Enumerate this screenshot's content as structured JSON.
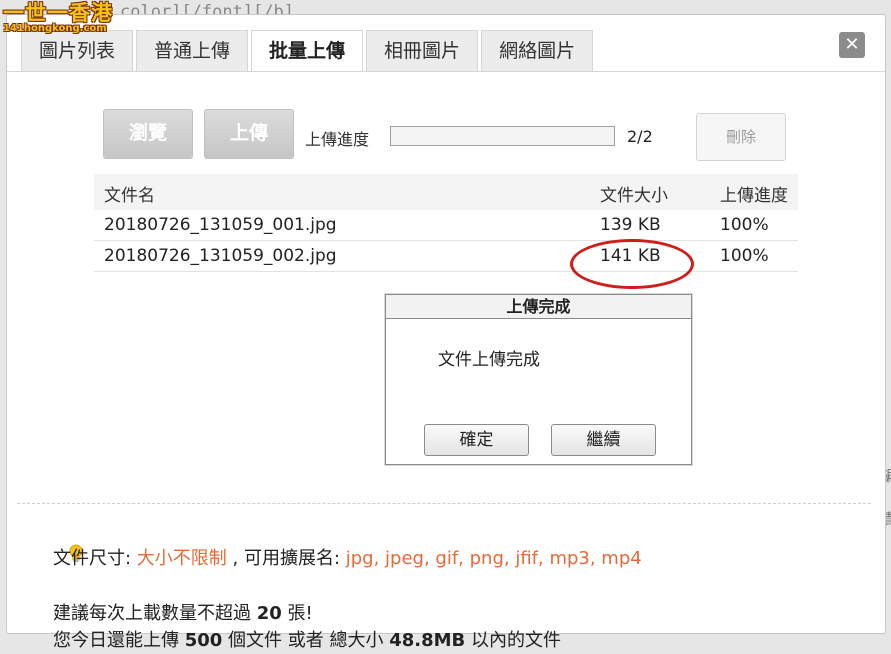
{
  "background_text": "color][/font][/b]",
  "right_edge_text": [
    "編",
    "責"
  ],
  "watermark": {
    "main": "一世一香港",
    "sub": "141hongkong.com"
  },
  "tabs": [
    {
      "label": "圖片列表",
      "active": false
    },
    {
      "label": "普通上傳",
      "active": false
    },
    {
      "label": "批量上傳",
      "active": true
    },
    {
      "label": "相冊圖片",
      "active": false
    },
    {
      "label": "網絡圖片",
      "active": false
    }
  ],
  "close_label": "✕",
  "toolbar": {
    "browse_label": "瀏覽",
    "upload_label": "上傳",
    "progress_label": "上傳進度",
    "progress_count": "2/2",
    "progress_value": 1.0,
    "delete_label": "刪除"
  },
  "table": {
    "headers": {
      "name": "文件名",
      "size": "文件大小",
      "progress": "上傳進度"
    },
    "rows": [
      {
        "name": "20180726_131059_001.jpg",
        "size": "139 KB",
        "progress": "100%"
      },
      {
        "name": "20180726_131059_002.jpg",
        "size": "141 KB",
        "progress": "100%"
      }
    ]
  },
  "modal": {
    "title": "上傳完成",
    "message": "文件上傳完成",
    "confirm_label": "確定",
    "continue_label": "繼續"
  },
  "info": {
    "icon": "lightbulb-icon",
    "line1": {
      "prefix": "文件尺寸: ",
      "size_value": "大小不限制",
      "mid": " , 可用擴展名: ",
      "extensions": "jpg, jpeg, gif, png, jfif, mp3, mp4"
    },
    "line2": {
      "prefix": "建議每次上載數量不超過 ",
      "count": "20",
      "suffix": " 張!"
    },
    "line3": {
      "prefix": "您今日還能上傳 ",
      "files": "500",
      "mid": " 個文件 或者 總大小 ",
      "size": "48.8MB",
      "suffix": " 以內的文件"
    }
  },
  "colors": {
    "accent_orange": "#e66a36",
    "annotation_red": "#d11c1c",
    "button_gray": "#c6c6c6"
  }
}
